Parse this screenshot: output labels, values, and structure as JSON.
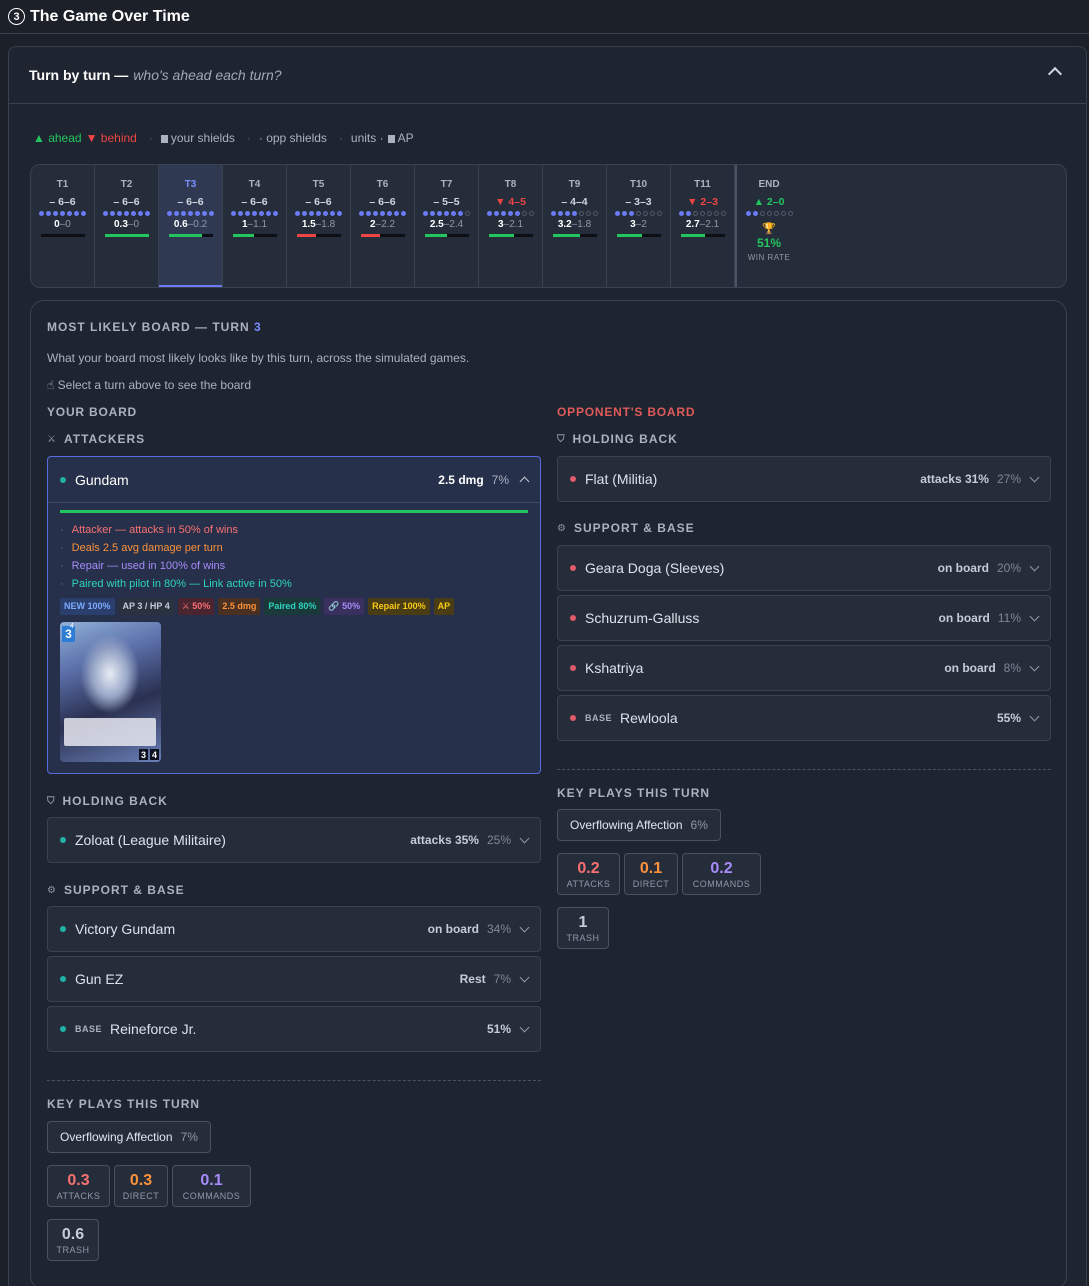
{
  "header": {
    "icon": "3",
    "title": "The Game Over Time"
  },
  "panel": {
    "title": "Turn by turn —",
    "subtitle": "who's ahead each turn?"
  },
  "legend": {
    "ahead": "▲ ahead",
    "behind": "▼ behind",
    "your_shields": "your shields",
    "opp_shields": "· opp shields",
    "units": "units ·",
    "ap": "AP"
  },
  "turns": [
    {
      "label": "T1",
      "score": "– 6–6",
      "trend": "even",
      "shields_on": 7,
      "units": "0",
      "opp": "–0",
      "bar_fraction": 0,
      "bar_color": "#22c55e"
    },
    {
      "label": "T2",
      "score": "– 6–6",
      "trend": "even",
      "shields_on": 7,
      "units": "0.3",
      "opp": "–0",
      "bar_fraction": 1,
      "bar_color": "#22c55e"
    },
    {
      "label": "T3",
      "score": "– 6–6",
      "trend": "even",
      "shields_on": 7,
      "units": "0.6",
      "opp": "–0.2",
      "bar_fraction": 0.75,
      "bar_color": "#22c55e"
    },
    {
      "label": "T4",
      "score": "– 6–6",
      "trend": "even",
      "shields_on": 7,
      "units": "1",
      "opp": "–1.1",
      "bar_fraction": 0.48,
      "bar_color": "#22c55e"
    },
    {
      "label": "T5",
      "score": "– 6–6",
      "trend": "even",
      "shields_on": 7,
      "units": "1.5",
      "opp": "–1.8",
      "bar_fraction": 0.45,
      "bar_color": "#ef4444"
    },
    {
      "label": "T6",
      "score": "– 6–6",
      "trend": "even",
      "shields_on": 7,
      "units": "2",
      "opp": "–2.2",
      "bar_fraction": 0.45,
      "bar_color": "#ef4444"
    },
    {
      "label": "T7",
      "score": "– 5–5",
      "trend": "even",
      "shields_on": 6,
      "units": "2.5",
      "opp": "–2.4",
      "bar_fraction": 0.5,
      "bar_color": "#22c55e"
    },
    {
      "label": "T8",
      "score": "▼ 4–5",
      "trend": "down",
      "shields_on": 5,
      "units": "3",
      "opp": "–2.1",
      "bar_fraction": 0.58,
      "bar_color": "#22c55e"
    },
    {
      "label": "T9",
      "score": "– 4–4",
      "trend": "even",
      "shields_on": 4,
      "units": "3.2",
      "opp": "–1.8",
      "bar_fraction": 0.63,
      "bar_color": "#22c55e"
    },
    {
      "label": "T10",
      "score": "– 3–3",
      "trend": "even",
      "shields_on": 3,
      "units": "3",
      "opp": "–2",
      "bar_fraction": 0.58,
      "bar_color": "#22c55e"
    },
    {
      "label": "T11",
      "score": "▼ 2–3",
      "trend": "down",
      "shields_on": 2,
      "units": "2.7",
      "opp": "–2.1",
      "bar_fraction": 0.55,
      "bar_color": "#22c55e"
    }
  ],
  "end": {
    "label": "END",
    "score": "▲ 2–0",
    "shields_on": 2,
    "win_pct": "51%",
    "win_label": "WIN RATE"
  },
  "board": {
    "title_prefix": "MOST LIKELY BOARD — TURN",
    "turn": "3",
    "description": "What your board most likely looks like by this turn, across the simulated games.",
    "hint": "Select a turn above to see the board",
    "your_board": "YOUR BOARD",
    "opp_board": "OPPONENT'S BOARD",
    "attackers_label": "ATTACKERS",
    "holding_back_label": "HOLDING BACK",
    "support_label": "SUPPORT & BASE",
    "key_plays_label": "KEY PLAYS THIS TURN"
  },
  "attacker": {
    "name": "Gundam",
    "stat": "2.5 dmg",
    "pct": "7%",
    "facts": [
      "Attacker — attacks in 50% of wins",
      "Deals 2.5 avg damage per turn",
      "Repair — used in 100% of wins",
      "Paired with pilot in 80% — Link active in 50%"
    ],
    "tags": [
      "NEW 100%",
      "AP 3 / HP 4",
      "⚔ 50%",
      "2.5 dmg",
      "Paired 80%",
      "🔗 50%",
      "Repair 100%",
      "AP"
    ],
    "card": {
      "cost": "3",
      "level": "4",
      "ap": "3",
      "hp": "4"
    }
  },
  "your_holding": [
    {
      "name": "Zoloat (League Militaire)",
      "stat": "attacks 35%",
      "pct": "25%"
    }
  ],
  "your_support": [
    {
      "name": "Victory Gundam",
      "stat": "on board",
      "pct": "34%",
      "base": ""
    },
    {
      "name": "Gun EZ",
      "stat": "Rest",
      "pct": "7%",
      "base": ""
    },
    {
      "name": "Reineforce Jr.",
      "stat": "",
      "pct": "51%",
      "base": "BASE"
    }
  ],
  "your_keyplay": {
    "name": "Overflowing Affection",
    "pct": "7%"
  },
  "your_stats": [
    {
      "value": "0.3",
      "label": "ATTACKS",
      "color": "red"
    },
    {
      "value": "0.3",
      "label": "DIRECT",
      "color": "org"
    },
    {
      "value": "0.1",
      "label": "COMMANDS",
      "color": "pur"
    },
    {
      "value": "0.6",
      "label": "TRASH",
      "color": "gry"
    }
  ],
  "opp_holding": [
    {
      "name": "Flat (Militia)",
      "stat": "attacks 31%",
      "pct": "27%"
    }
  ],
  "opp_support": [
    {
      "name": "Geara Doga (Sleeves)",
      "stat": "on board",
      "pct": "20%",
      "base": ""
    },
    {
      "name": "Schuzrum-Galluss",
      "stat": "on board",
      "pct": "11%",
      "base": ""
    },
    {
      "name": "Kshatriya",
      "stat": "on board",
      "pct": "8%",
      "base": ""
    },
    {
      "name": "Rewloola",
      "stat": "",
      "pct": "55%",
      "base": "BASE"
    }
  ],
  "opp_keyplay": {
    "name": "Overflowing Affection",
    "pct": "6%"
  },
  "opp_stats": [
    {
      "value": "0.2",
      "label": "ATTACKS",
      "color": "red"
    },
    {
      "value": "0.1",
      "label": "DIRECT",
      "color": "org"
    },
    {
      "value": "0.2",
      "label": "COMMANDS",
      "color": "pur"
    },
    {
      "value": "1",
      "label": "TRASH",
      "color": "gry"
    }
  ],
  "colors": {
    "accent": "#6b7cf6",
    "ahead": "#22c55e",
    "behind": "#ef4444",
    "teal": "#20b2a6",
    "opp": "#e05a6a"
  }
}
